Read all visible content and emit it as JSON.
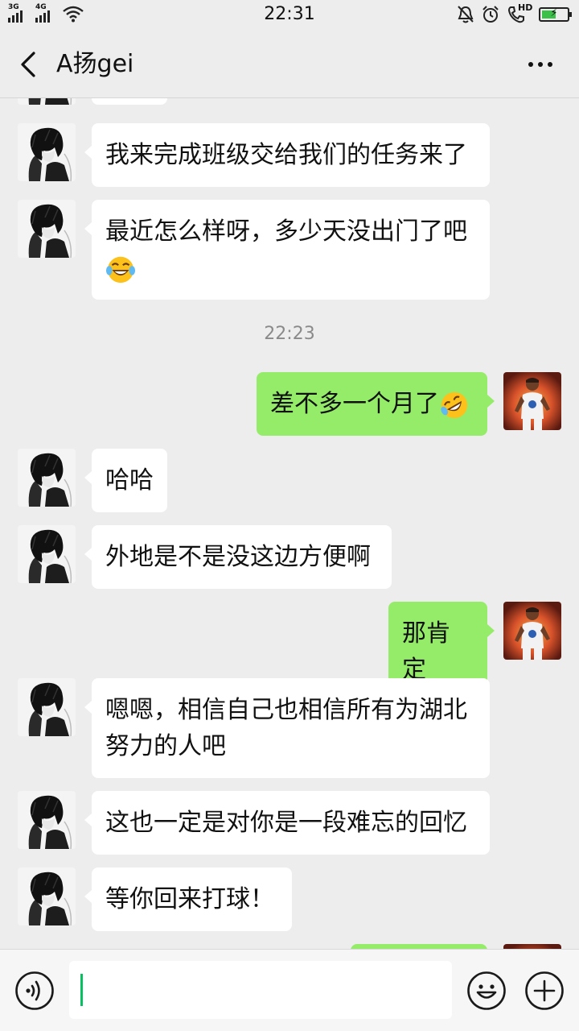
{
  "status_bar": {
    "time": "22:31",
    "network_1": "3G",
    "network_2": "4G",
    "hd_label": "HD",
    "battery_level": 0.55
  },
  "chat": {
    "title": "A扬gei"
  },
  "messages": [
    {
      "id": "partial",
      "side": "in",
      "text": ""
    },
    {
      "id": "m1",
      "side": "in",
      "text": "我来完成班级交给我们的任务来了"
    },
    {
      "id": "m2",
      "side": "in",
      "text": "最近怎么样呀，多少天没出门了吧",
      "emoji": "laugh-cry-emoji"
    },
    {
      "id": "ts",
      "type": "timestamp",
      "text": "22:23"
    },
    {
      "id": "m3",
      "side": "out",
      "text": "差不多一个月了",
      "emoji": "rofl-emoji"
    },
    {
      "id": "m4",
      "side": "in",
      "text": "哈哈"
    },
    {
      "id": "m5",
      "side": "in",
      "text": "外地是不是没这边方便啊"
    },
    {
      "id": "m6",
      "side": "out",
      "text": "那肯定"
    },
    {
      "id": "m7",
      "side": "in",
      "text": "嗯嗯，相信自己也相信所有为湖北努力的人吧"
    },
    {
      "id": "m8",
      "side": "in",
      "text": "这也一定是对你是一段难忘的回忆"
    },
    {
      "id": "m9",
      "side": "in",
      "text": "等你回来打球！"
    },
    {
      "id": "partial_out",
      "side": "out",
      "text": ""
    }
  ],
  "colors": {
    "incoming_bubble": "#ffffff",
    "outgoing_bubble": "#95ec69",
    "background": "#ededed",
    "accent": "#07c160"
  },
  "icons": {
    "back": "back-chevron-icon",
    "more": "more-dots-icon",
    "voice": "voice-icon",
    "emoji": "emoji-icon",
    "plus": "plus-icon"
  }
}
